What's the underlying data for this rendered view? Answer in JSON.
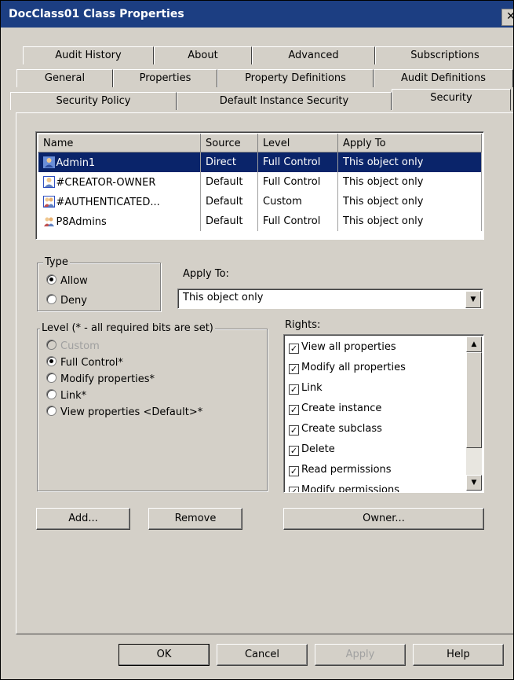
{
  "window": {
    "title": "DocClass01 Class Properties",
    "close_label": "✕"
  },
  "tabs": {
    "row1": [
      "Audit History",
      "About",
      "Advanced",
      "Subscriptions"
    ],
    "row2": [
      "General",
      "Properties",
      "Property Definitions",
      "Audit Definitions"
    ],
    "row3": [
      "Security Policy",
      "Default Instance Security",
      "Security"
    ],
    "active": "Security"
  },
  "permissions": {
    "columns": [
      "Name",
      "Source",
      "Level",
      "Apply To"
    ],
    "rows": [
      {
        "name": "Admin1",
        "source": "Direct",
        "level": "Full Control",
        "apply_to": "This object only",
        "icon": "user-icon",
        "selected": true
      },
      {
        "name": "#CREATOR-OWNER",
        "source": "Default",
        "level": "Full Control",
        "apply_to": "This object only",
        "icon": "user-icon"
      },
      {
        "name": "#AUTHENTICATED...",
        "source": "Default",
        "level": "Custom",
        "apply_to": "This object only",
        "icon": "group-icon"
      },
      {
        "name": "P8Admins",
        "source": "Default",
        "level": "Full Control",
        "apply_to": "This object only",
        "icon": "group-icon"
      }
    ]
  },
  "type": {
    "label": "Type",
    "allow": "Allow",
    "deny": "Deny",
    "selected": "Allow"
  },
  "apply_to": {
    "label": "Apply To:",
    "value": "This object only"
  },
  "level": {
    "label": "Level (* - all required bits are set)",
    "options": [
      "Custom",
      "Full Control*",
      "Modify properties*",
      "Link*",
      "View properties <Default>*"
    ],
    "selected": "Full Control*"
  },
  "rights": {
    "label": "Rights:",
    "items": [
      "View all properties",
      "Modify all properties",
      "Link",
      "Create instance",
      "Create subclass",
      "Delete",
      "Read permissions",
      "Modify permissions"
    ]
  },
  "buttons": {
    "add": "Add...",
    "remove": "Remove",
    "owner": "Owner...",
    "ok": "OK",
    "cancel": "Cancel",
    "apply": "Apply",
    "help": "Help"
  }
}
